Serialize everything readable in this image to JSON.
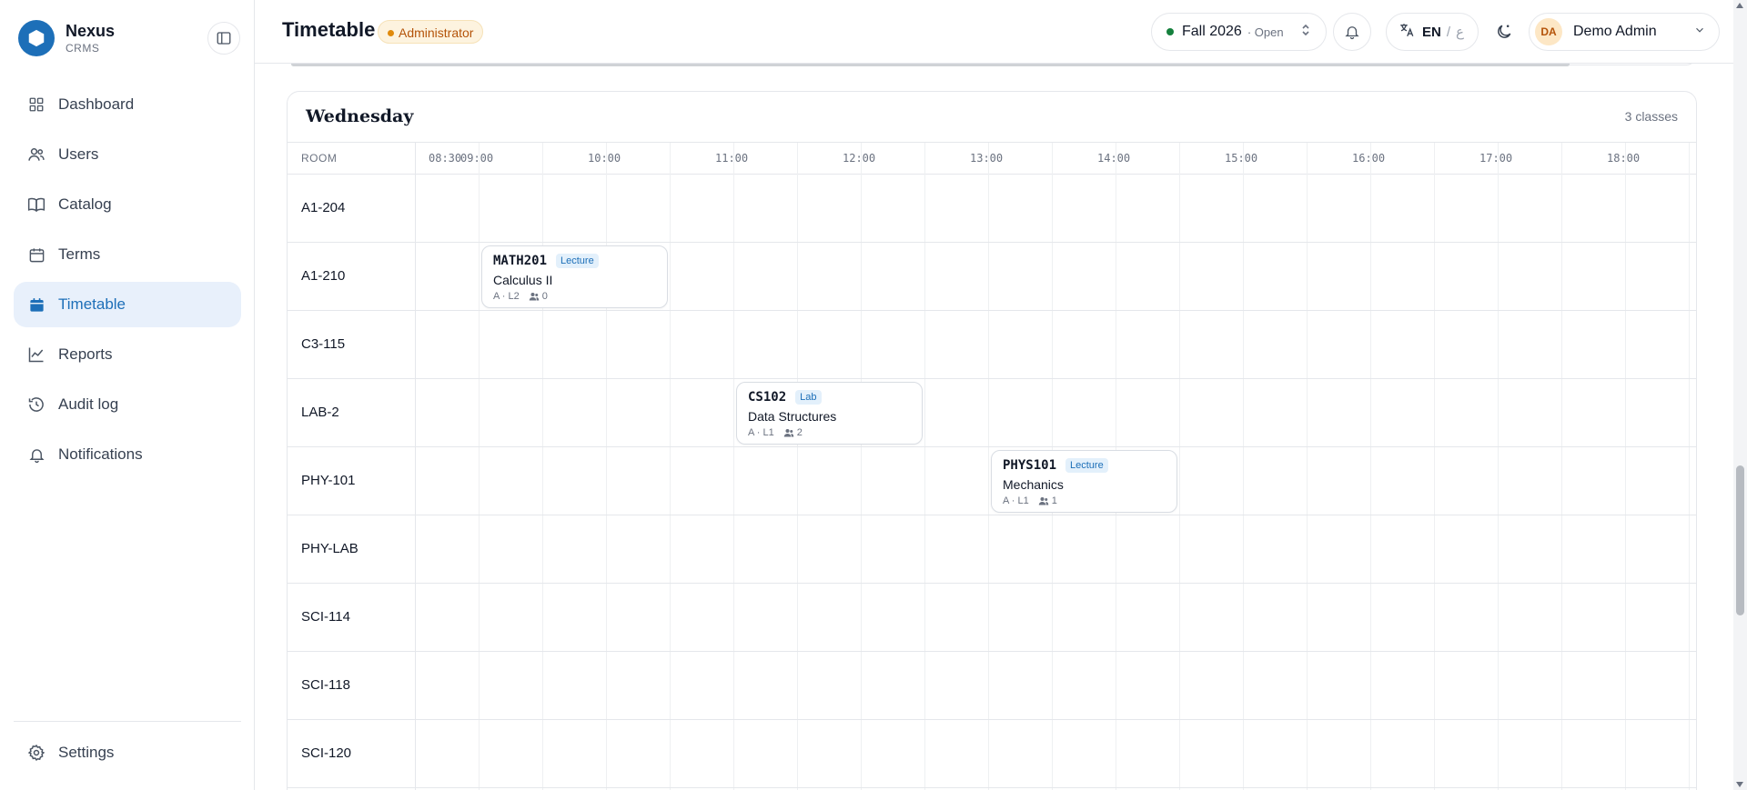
{
  "brand": {
    "name": "Nexus",
    "subtitle": "CRMS",
    "color": "#1d6fb8"
  },
  "sidebar": {
    "items": [
      {
        "label": "Dashboard",
        "icon": "grid-icon",
        "active": false
      },
      {
        "label": "Users",
        "icon": "users-icon",
        "active": false
      },
      {
        "label": "Catalog",
        "icon": "book-icon",
        "active": false
      },
      {
        "label": "Terms",
        "icon": "calendar-icon",
        "active": false
      },
      {
        "label": "Timetable",
        "icon": "calendar-filled-icon",
        "active": true
      },
      {
        "label": "Reports",
        "icon": "chart-line-icon",
        "active": false
      },
      {
        "label": "Audit log",
        "icon": "history-icon",
        "active": false
      },
      {
        "label": "Notifications",
        "icon": "bell-icon",
        "active": false
      }
    ],
    "settings_label": "Settings"
  },
  "header": {
    "title": "Timetable",
    "role_badge": "Administrator",
    "term": {
      "name": "Fall 2026",
      "status": "· Open"
    },
    "language": {
      "current": "EN",
      "separator": "/",
      "alternate": "ع"
    },
    "user": {
      "initials": "DA",
      "name": "Demo Admin"
    }
  },
  "day": {
    "title": "Wednesday",
    "count": "3 classes",
    "room_header": "ROOM",
    "times": [
      "08:30",
      "09:00",
      "10:00",
      "11:00",
      "12:00",
      "13:00",
      "14:00",
      "15:00",
      "16:00",
      "17:00",
      "18:00"
    ],
    "rooms": [
      "A1-204",
      "A1-210",
      "C3-115",
      "LAB-2",
      "PHY-101",
      "PHY-LAB",
      "SCI-114",
      "SCI-118",
      "SCI-120"
    ],
    "events": [
      {
        "code": "MATH201",
        "type": "Lecture",
        "title": "Calculus II",
        "section": "A · L2",
        "enrolled": "0"
      },
      {
        "code": "CS102",
        "type": "Lab",
        "title": "Data Structures",
        "section": "A · L1",
        "enrolled": "2"
      },
      {
        "code": "PHYS101",
        "type": "Lecture",
        "title": "Mechanics",
        "section": "A · L1",
        "enrolled": "1"
      }
    ]
  }
}
